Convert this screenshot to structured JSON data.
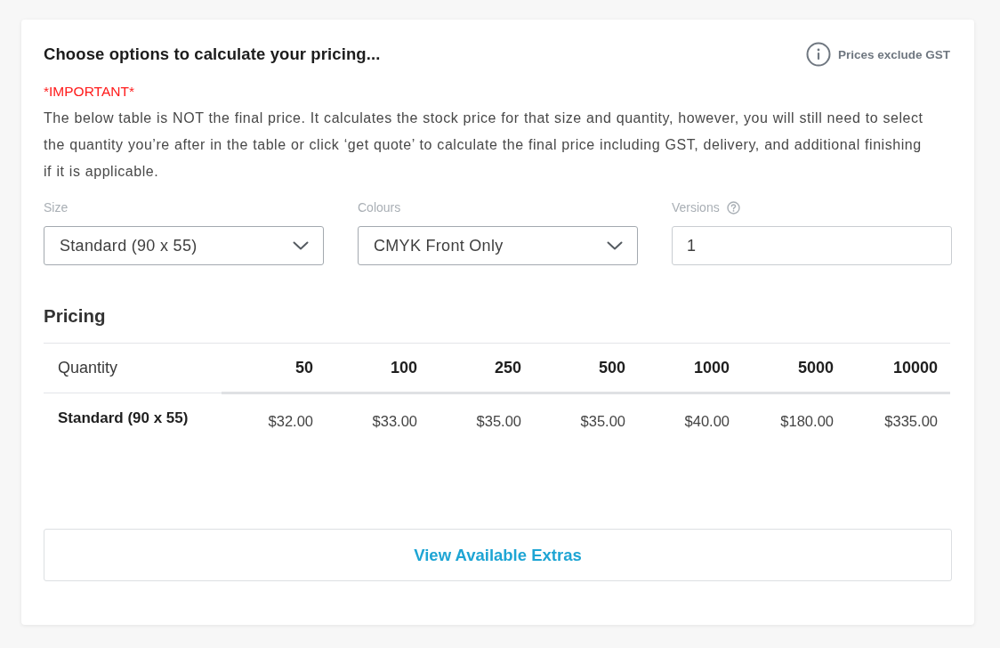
{
  "header": {
    "title": "Choose options to calculate your pricing...",
    "note": "Prices exclude GST"
  },
  "notice": {
    "label": "*IMPORTANT*",
    "text": "The below table is NOT the final price. It calculates the stock price for that size and quantity, however, you will still need to select the quantity you’re after in the table or click ‘get quote’ to calculate the final price including GST, delivery, and additional finishing if it is applicable."
  },
  "fields": [
    {
      "label": "Size",
      "kind": "select",
      "value": "Standard (90 x 55)",
      "help": false
    },
    {
      "label": "Colours",
      "kind": "select",
      "value": "CMYK Front Only",
      "help": false
    },
    {
      "label": "Versions",
      "kind": "input",
      "value": "1",
      "help": true
    }
  ],
  "pricing": {
    "title": "Pricing",
    "header_label": "Quantity",
    "quantities": [
      "50",
      "100",
      "250",
      "500",
      "1000",
      "5000",
      "10000"
    ],
    "rows": [
      {
        "label": "Standard (90 x 55)",
        "prices": [
          "$32.00",
          "$33.00",
          "$35.00",
          "$35.00",
          "$40.00",
          "$180.00",
          "$335.00"
        ]
      }
    ]
  },
  "extras_button": {
    "label": "View Available Extras"
  }
}
